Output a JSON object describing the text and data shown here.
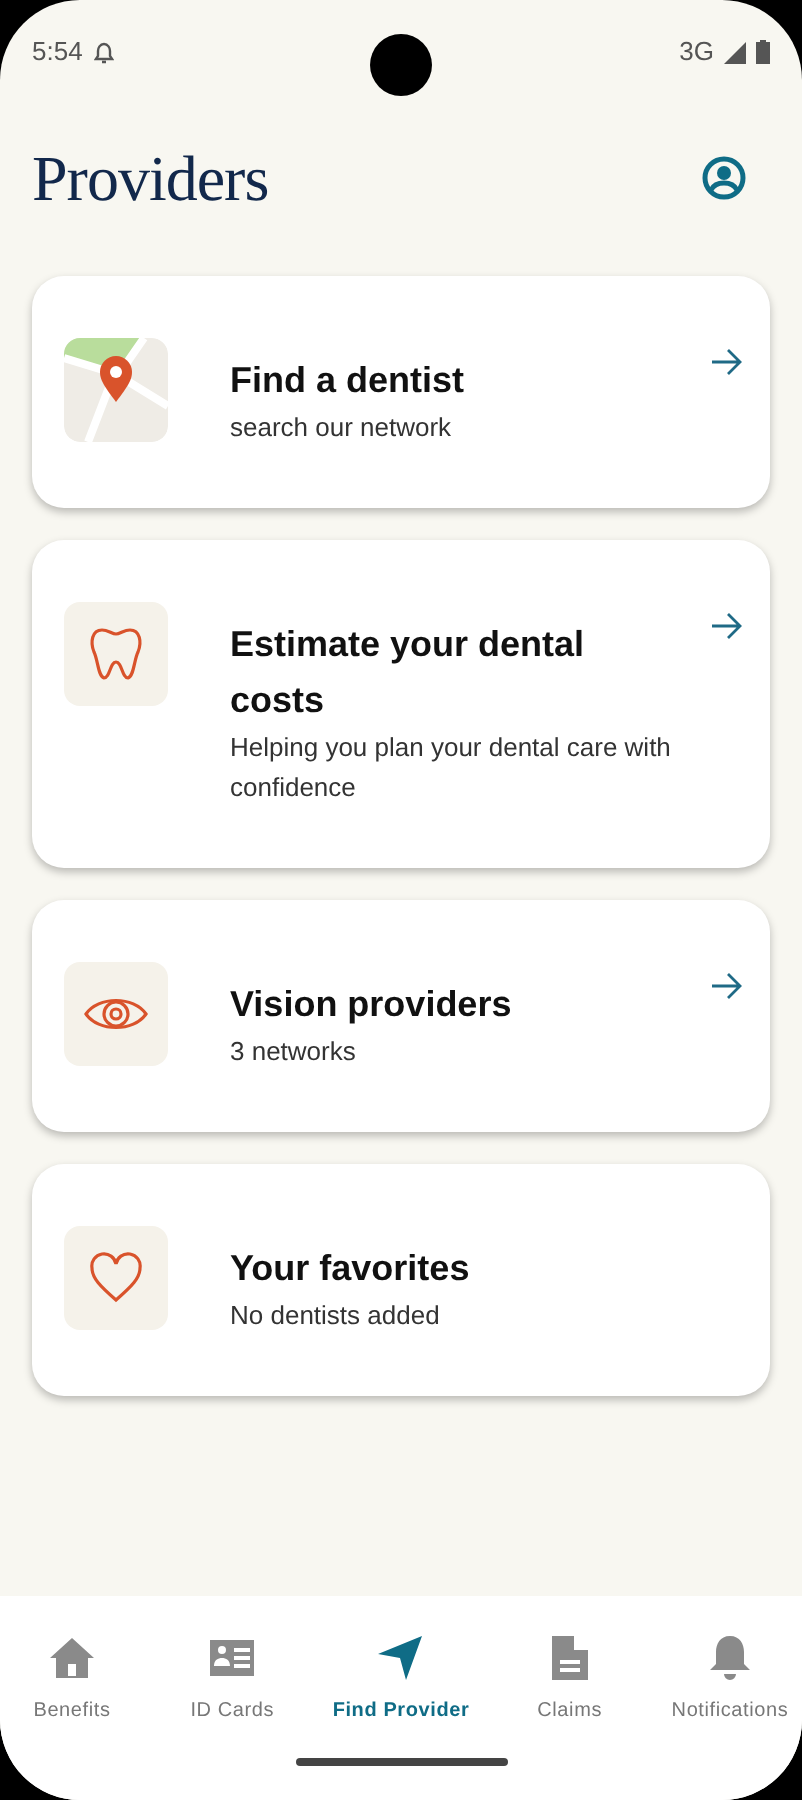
{
  "status_bar": {
    "time": "5:54",
    "network": "3G"
  },
  "header": {
    "title": "Providers"
  },
  "cards": [
    {
      "kind": "map",
      "title": "Find a dentist",
      "subtitle": "search our network",
      "arrow": true
    },
    {
      "kind": "tooth",
      "title": "Estimate your dental costs",
      "subtitle": "Helping you plan your dental care with confidence",
      "arrow": true
    },
    {
      "kind": "eye",
      "title": "Vision providers",
      "subtitle": "3 networks",
      "arrow": true
    },
    {
      "kind": "heart",
      "title": "Your favorites",
      "subtitle": "No dentists added",
      "arrow": false
    }
  ],
  "nav": [
    {
      "kind": "home",
      "label": "Benefits",
      "selected": false
    },
    {
      "kind": "card",
      "label": "ID Cards",
      "selected": false
    },
    {
      "kind": "navigate",
      "label": "Find Provider",
      "selected": true
    },
    {
      "kind": "document",
      "label": "Claims",
      "selected": false
    },
    {
      "kind": "bell",
      "label": "Notifications",
      "selected": false
    }
  ]
}
